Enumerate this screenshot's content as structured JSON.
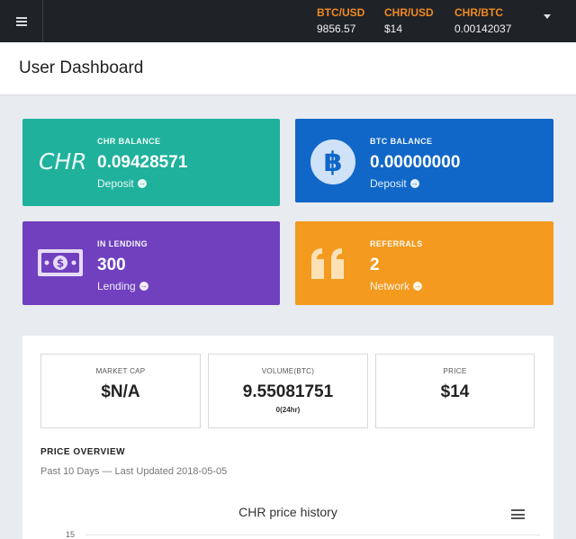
{
  "topbar": {
    "tickers": [
      {
        "pair": "BTC/USD",
        "value": "9856.57"
      },
      {
        "pair": "CHR/USD",
        "value": "$14"
      },
      {
        "pair": "CHR/BTC",
        "value": "0.00142037"
      }
    ]
  },
  "header": {
    "title": "User Dashboard"
  },
  "cards": {
    "chr": {
      "logo": "CHR",
      "label": "CHR BALANCE",
      "value": "0.09428571",
      "link": "Deposit",
      "color": "#1fb19c"
    },
    "btc": {
      "label": "BTC BALANCE",
      "value": "0.00000000",
      "link": "Deposit",
      "color": "#1067c8"
    },
    "lending": {
      "label": "IN LENDING",
      "value": "300",
      "link": "Lending",
      "color": "#7040bf"
    },
    "referrals": {
      "label": "REFERRALS",
      "value": "2",
      "link": "Network",
      "color": "#f39a1f"
    }
  },
  "stats": {
    "market_cap": {
      "label": "MARKET CAP",
      "value": "$N/A"
    },
    "volume": {
      "label": "VOLUME(BTC)",
      "value": "9.55081751",
      "sub": "0(24hr)"
    },
    "price": {
      "label": "PRICE",
      "value": "$14"
    }
  },
  "overview": {
    "title": "PRICE OVERVIEW",
    "subtitle": "Past 10 Days — Last Updated 2018-05-05"
  },
  "chart_data": {
    "type": "line",
    "title": "CHR price history",
    "y_ticks": [
      "15"
    ],
    "series": []
  },
  "icons": [
    "menu-icon",
    "chevron-down-icon",
    "bitcoin-icon",
    "money-bill-icon",
    "quote-icon",
    "arrow-circle-icon",
    "chart-menu-icon"
  ]
}
